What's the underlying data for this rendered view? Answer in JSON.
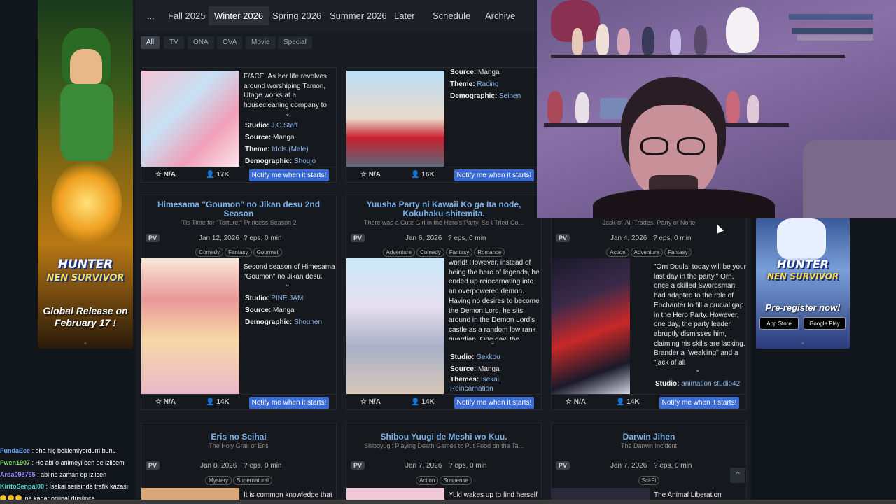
{
  "nav": {
    "ellipsis": "...",
    "items": [
      "Fall 2025",
      "Winter 2026",
      "Spring 2026",
      "Summer 2026",
      "Later",
      "Schedule",
      "Archive"
    ],
    "active": "Winter 2026"
  },
  "filters": [
    "All",
    "TV",
    "ONA",
    "OVA",
    "Movie",
    "Special"
  ],
  "cards": [
    {
      "synopsis": "F/ACE. As her life revolves around worshiping Tamon, Utage works at a housecleaning company to earn money and",
      "meta": [
        {
          "k": "Studio:",
          "v": "J.C.Staff",
          "link": true
        },
        {
          "k": "Source:",
          "v": "Manga",
          "link": false
        },
        {
          "k": "Theme:",
          "v": "Idols (Male)",
          "link": true
        },
        {
          "k": "Demographic:",
          "v": "Shoujo",
          "link": true
        }
      ],
      "score": "N/A",
      "members": "17K",
      "notify": "Notify me when it starts!"
    },
    {
      "synopsis": "",
      "meta": [
        {
          "k": "Source:",
          "v": "Manga",
          "link": false
        },
        {
          "k": "Theme:",
          "v": "Racing",
          "link": true
        },
        {
          "k": "Demographic:",
          "v": "Seinen",
          "link": true
        }
      ],
      "score": "N/A",
      "members": "16K",
      "notify": "Notify me when it starts!"
    },
    {
      "title": "Himesama \"Goumon\" no Jikan desu 2nd Season",
      "subtitle": "'Tis Time for \"Torture,\" Princess Season 2",
      "pv": "PV",
      "date": "Jan 12, 2026",
      "eps": "? eps, 0 min",
      "tags": [
        "Comedy",
        "Fantasy",
        "Gourmet"
      ],
      "synopsis": "Second season of Himesama \"Goumon\" no Jikan desu.",
      "meta": [
        {
          "k": "Studio:",
          "v": "PINE JAM",
          "link": true
        },
        {
          "k": "Source:",
          "v": "Manga",
          "link": false
        },
        {
          "k": "Demographic:",
          "v": "Shounen",
          "link": true
        }
      ],
      "score": "N/A",
      "members": "14K",
      "notify": "Notify me when it starts!"
    },
    {
      "title": "Yuusha Party ni Kawaii Ko ga Ita node, Kokuhaku shitemita.",
      "subtitle": "There was a Cute Girl in the Hero's Party, So I Tried Co...",
      "pv": "PV",
      "date": "Jan 6, 2026",
      "eps": "? eps, 0 min",
      "tags": [
        "Adventure",
        "Comedy",
        "Fantasy",
        "Romance"
      ],
      "synopsis": "world! However, instead of being the hero of legends, he ended up reincarnating into an overpowered demon. Having no desires to become the Demon Lord, he sits around in the Demon Lord's castle as a random low rank guardian. One day, the Hero's party comes to",
      "meta": [
        {
          "k": "Studio:",
          "v": "Gekkou",
          "link": true
        },
        {
          "k": "Source:",
          "v": "Manga",
          "link": false
        },
        {
          "k": "Themes:",
          "v": "Isekai, Reincarnation",
          "link": true
        }
      ],
      "score": "N/A",
      "members": "14K",
      "notify": "Notify me when it starts!"
    },
    {
      "subtitle": "Jack-of-All-Trades, Party of None",
      "pv": "PV",
      "date": "Jan 4, 2026",
      "eps": "? eps, 0 min",
      "tags": [
        "Action",
        "Adventure",
        "Fantasy"
      ],
      "synopsis": "\"Orn Doula, today will be your last day in the party.\" Orn, once a skilled Swordsman, had adapted to the role of Enchanter to fill a crucial gap in the Hero Party. However, one day, the party leader abruptly dismisses him, claiming his skills are lacking. Brander a \"weakling\" and a \"jack of all",
      "meta": [
        {
          "k": "Studio:",
          "v": "animation studio42",
          "link": true
        }
      ],
      "score": "N/A",
      "members": "14K",
      "notify": "Notify me when it starts!"
    },
    {
      "title": "Eris no Seihai",
      "subtitle": "The Holy Grail of Eris",
      "pv": "PV",
      "date": "Jan 8, 2026",
      "eps": "? eps, 0 min",
      "tags": [
        "Mystery",
        "Supernatural"
      ],
      "synopsis": "It is common knowledge that"
    },
    {
      "title": "Shibou Yuugi de Meshi wo Kuu.",
      "subtitle": "Shiboyugi: Playing Death Games to Put Food on the Ta...",
      "pv": "PV",
      "date": "Jan 7, 2026",
      "eps": "? eps, 0 min",
      "tags": [
        "Action",
        "Suspense"
      ],
      "synopsis": "Yuki wakes up to find herself in"
    },
    {
      "title": "Darwin Jihen",
      "subtitle": "The Darwin Incident",
      "pv": "PV",
      "date": "Jan 7, 2026",
      "eps": "? eps, 0 min",
      "tags": [
        "Sci-Fi"
      ],
      "synopsis": "The Animal Liberation Alliance"
    }
  ],
  "banners": {
    "left": {
      "logo1": "HUNTER",
      "logo2": "NEN SURVIVOR",
      "tagline": "Global Release on February 17 !"
    },
    "right": {
      "logo1": "HUNTER",
      "logo2": "NEN SURVIVOR",
      "tagline": "Pre-register now!",
      "appstore": "App Store",
      "googleplay": "Google Play"
    }
  },
  "chat": [
    {
      "user": "FundaEce",
      "msg": ": oha hiç beklemiyordum bunu"
    },
    {
      "user": "Fwen1907",
      "msg": ": He abi o animeyi ben de izlicem"
    },
    {
      "user": "Arda098765",
      "msg": ": abi ne zaman op izlicen"
    },
    {
      "user": "KiritoSenpai00",
      "msg": ": İsekai serisinde trafik kazası"
    },
    {
      "user": "",
      "msg": "ne kadar orijinal düşünce"
    }
  ],
  "colors": {
    "accent": "#3a6ad4",
    "link": "#7cb0e8",
    "bg": "#181c22"
  }
}
